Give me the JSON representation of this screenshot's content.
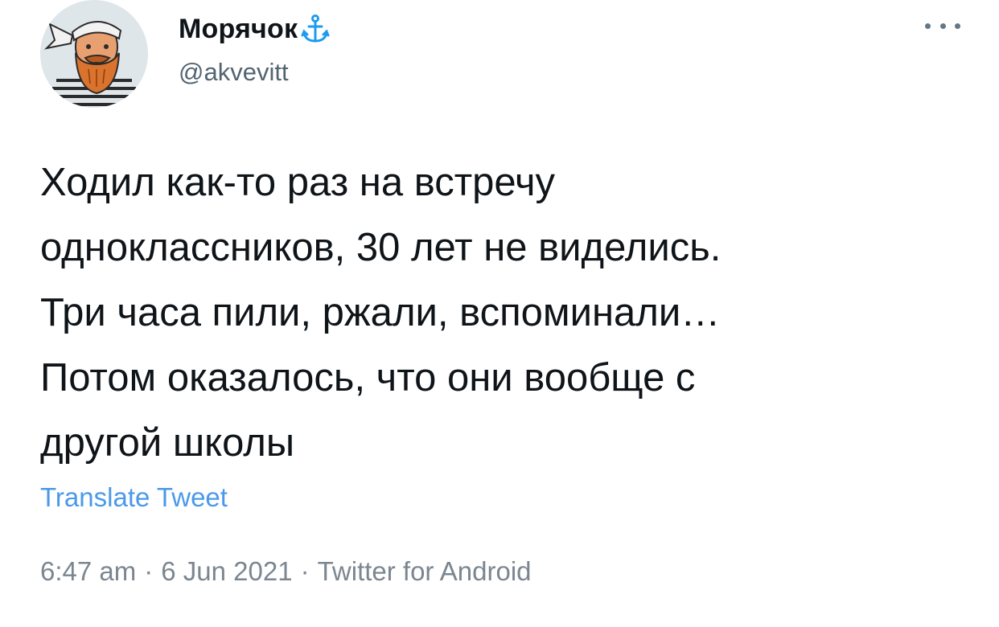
{
  "author": {
    "display_name": "Морячок",
    "handle": "@akvevitt",
    "badge_icon": "anchor-icon",
    "avatar_icon": "bearded-sailor-avatar"
  },
  "more_icon": "more-dots-icon",
  "tweet": {
    "lines": [
      "Ходил как-то раз на встречу",
      "одноклассников, 30 лет не виделись.",
      "Три часа пили, ржали, вспоминали…",
      "Потом оказалось, что они вообще с",
      "другой школы"
    ],
    "translate_label": "Translate Tweet",
    "time": "6:47 am",
    "date": "6 Jun 2021",
    "source": "Twitter for Android",
    "separator": "·"
  },
  "colors": {
    "text": "#0f1419",
    "secondary": "#536471",
    "link": "#4a99e9",
    "anchor": "#1d9bf0"
  }
}
